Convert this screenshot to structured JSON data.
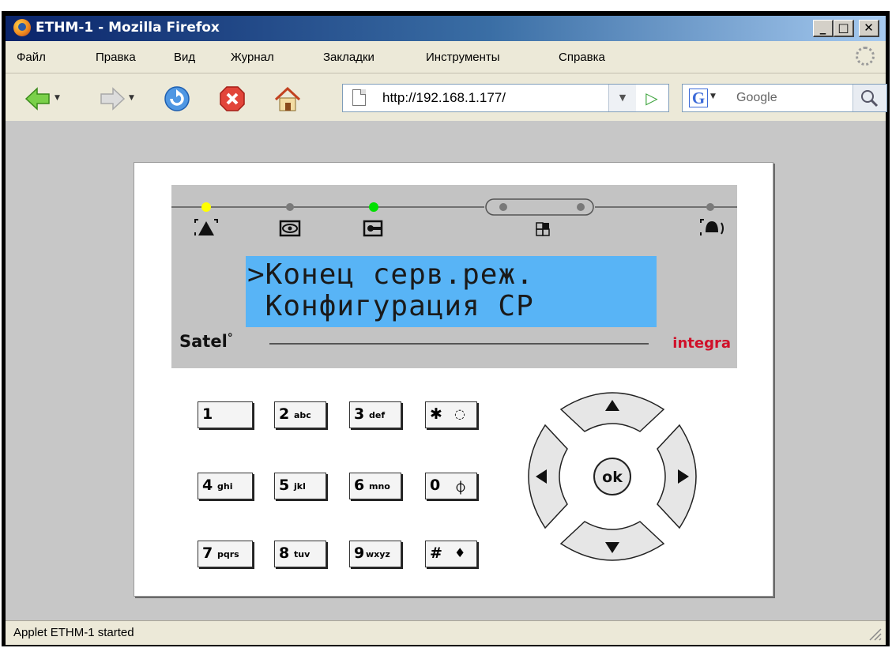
{
  "window": {
    "title": "ETHM-1 - Mozilla Firefox",
    "controls": {
      "minimize": "_",
      "maximize": "□",
      "close": "✕"
    }
  },
  "menu": [
    "Файл",
    "Правка",
    "Вид",
    "Журнал",
    "Закладки",
    "Инструменты",
    "Справка"
  ],
  "navigation": {
    "url": "http://192.168.1.177/",
    "search_placeholder": "Google",
    "search_engine_logo": "G"
  },
  "keypad": {
    "lcd": {
      "line1": ">Конец серв.реж.",
      "line2": " Конфигурация СР",
      "brand": "Satel",
      "brand_mark": "°",
      "product": "integra",
      "screen_color": "#58b4f6",
      "leds": [
        {
          "name": "alarm",
          "color": "#ffff00"
        },
        {
          "name": "armed",
          "color": "#7a7a7a"
        },
        {
          "name": "service",
          "color": "#00e000"
        },
        {
          "name": "partitions",
          "color": "#7a7a7a"
        },
        {
          "name": "trouble",
          "color": "#7a7a7a"
        }
      ]
    },
    "keys": [
      {
        "main": "1",
        "sub": ""
      },
      {
        "main": "2",
        "sub": "abc"
      },
      {
        "main": "3",
        "sub": "def"
      },
      {
        "main": "✱",
        "sub": "◌"
      },
      {
        "main": "4",
        "sub": "ghi"
      },
      {
        "main": "5",
        "sub": "jkl"
      },
      {
        "main": "6",
        "sub": "mno"
      },
      {
        "main": "0",
        "sub": "⏀"
      },
      {
        "main": "7",
        "sub": "pqrs"
      },
      {
        "main": "8",
        "sub": "tuv"
      },
      {
        "main": "9",
        "sub": "wxyz"
      },
      {
        "main": "#",
        "sub": "♦"
      }
    ],
    "ok_label": "ok"
  },
  "status": "Applet ETHM-1 started",
  "colors": {
    "title_bar": "#0a246a",
    "chrome": "#ece9d8",
    "content_bg": "#c7c7c7",
    "brand_red": "#d0102a"
  }
}
